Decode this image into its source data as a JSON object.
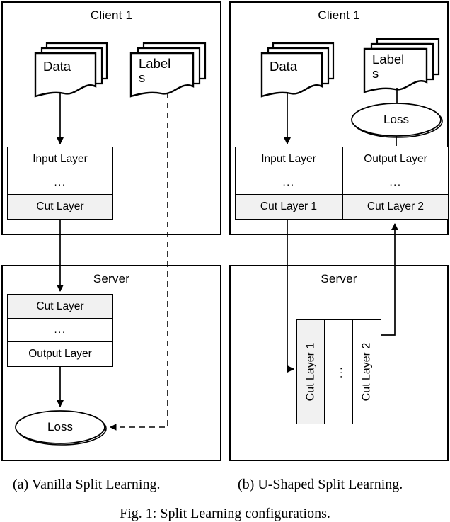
{
  "figure": {
    "caption": "Fig. 1: Split Learning configurations.",
    "subfigures": [
      {
        "id": "a",
        "caption": "(a) Vanilla Split Learning."
      },
      {
        "id": "b",
        "caption": "(b) U-Shaped Split Learning."
      }
    ]
  },
  "vanilla": {
    "client_panel": {
      "title": "Client 1",
      "data_node": {
        "label": "Data"
      },
      "labels_node": {
        "label": "Label\ns"
      },
      "stack": {
        "layers": [
          {
            "label": "Input Layer",
            "highlight": false
          },
          {
            "label": "...",
            "highlight": false
          },
          {
            "label": "Cut Layer",
            "highlight": true
          }
        ]
      }
    },
    "server_panel": {
      "title": "Server",
      "stack": {
        "layers": [
          {
            "label": "Cut Layer",
            "highlight": true
          },
          {
            "label": "...",
            "highlight": false
          },
          {
            "label": "Output Layer",
            "highlight": false
          }
        ]
      },
      "loss_node": {
        "label": "Loss"
      }
    }
  },
  "ushaped": {
    "client_panel": {
      "title": "Client 1",
      "data_node": {
        "label": "Data"
      },
      "labels_node": {
        "label": "Label\ns"
      },
      "loss_node": {
        "label": "Loss"
      },
      "left_stack": {
        "layers": [
          {
            "label": "Input Layer",
            "highlight": false
          },
          {
            "label": "...",
            "highlight": false
          },
          {
            "label": "Cut Layer 1",
            "highlight": true
          }
        ]
      },
      "right_stack": {
        "layers": [
          {
            "label": "Output Layer",
            "highlight": false
          },
          {
            "label": "...",
            "highlight": false
          },
          {
            "label": "Cut Layer 2",
            "highlight": true
          }
        ]
      }
    },
    "server_panel": {
      "title": "Server",
      "vertical_stack": {
        "layers": [
          {
            "label": "Cut Layer 1",
            "highlight": true
          },
          {
            "label": "...",
            "highlight": false
          },
          {
            "label": "Cut Layer 2",
            "highlight": false
          }
        ]
      }
    }
  },
  "colors": {
    "stroke": "#000000",
    "highlight_fill": "#f1f1f1",
    "background": "#ffffff"
  }
}
